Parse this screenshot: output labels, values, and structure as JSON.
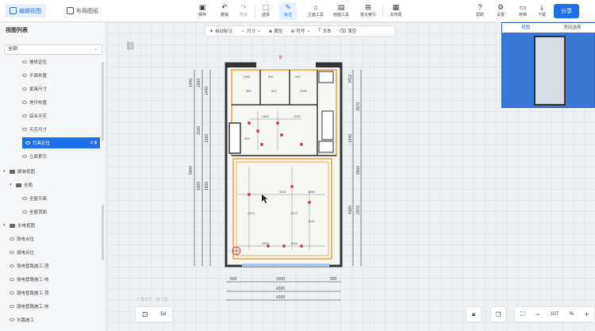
{
  "topbar": {
    "tabs": [
      {
        "label": "编辑视图",
        "active": true
      },
      {
        "label": "布局图纸",
        "active": false
      }
    ],
    "tools": [
      {
        "label": "保存",
        "icon": "save-icon",
        "glyph": "▣"
      },
      {
        "label": "撤销",
        "icon": "undo-icon",
        "glyph": "↶"
      },
      {
        "label": "重做",
        "icon": "redo-icon",
        "glyph": "↷",
        "disabled": true
      },
      {
        "label": "选择",
        "icon": "select-icon",
        "glyph": "⬚"
      },
      {
        "label": "标注",
        "icon": "annotate-icon",
        "glyph": "✎",
        "active": true
      },
      {
        "label": "立面工具",
        "icon": "elevation-icon",
        "glyph": "⌂"
      },
      {
        "label": "剖面工具",
        "icon": "section-icon",
        "glyph": "▤"
      },
      {
        "label": "放大索引",
        "icon": "zoom-index-icon",
        "glyph": "⊞"
      },
      {
        "label": "去布局",
        "icon": "layout-icon",
        "glyph": "▦"
      }
    ],
    "right_tools": [
      {
        "label": "帮助",
        "icon": "help-icon",
        "glyph": "?"
      },
      {
        "label": "设置",
        "icon": "settings-icon",
        "glyph": "⚙"
      },
      {
        "label": "存档",
        "icon": "archive-icon",
        "glyph": "▭"
      },
      {
        "label": "下载",
        "icon": "download-icon",
        "glyph": "⤓"
      }
    ],
    "share_label": "分享"
  },
  "sidebar": {
    "title": "视图列表",
    "select_value": "全部",
    "items": [
      {
        "label": "墙体定位",
        "level": 2
      },
      {
        "label": "平面布置",
        "level": 2
      },
      {
        "label": "家具尺寸",
        "level": 2
      },
      {
        "label": "地坪布置",
        "level": 2
      },
      {
        "label": "综合天花",
        "level": 2
      },
      {
        "label": "天花尺寸",
        "level": 2
      },
      {
        "label": "灯具定位",
        "level": 2,
        "selected": true
      },
      {
        "label": "立面索引",
        "level": 2
      },
      {
        "label": "硬装视图",
        "level": 0,
        "folder": true
      },
      {
        "label": "全局",
        "level": 1,
        "folder": true
      },
      {
        "label": "全屋平面",
        "level": 2
      },
      {
        "label": "全屋顶面",
        "level": 2
      },
      {
        "label": "水电视图",
        "level": 0,
        "folder": true
      },
      {
        "label": "强电点位",
        "level": 1
      },
      {
        "label": "弱电点位",
        "level": 1
      },
      {
        "label": "强电管路施工-顶",
        "level": 1
      },
      {
        "label": "强电管路施工-地",
        "level": 1
      },
      {
        "label": "弱电管路施工-顶",
        "level": 1
      },
      {
        "label": "弱电管路施工-地",
        "level": 1
      },
      {
        "label": "水路施工",
        "level": 1
      }
    ]
  },
  "canvas_toolbar": [
    {
      "label": "自动标注",
      "icon": "auto-annotate-icon",
      "glyph": "✦"
    },
    {
      "label": "尺寸",
      "icon": "dimension-icon",
      "glyph": "↔"
    },
    {
      "label": "属性",
      "icon": "property-icon",
      "glyph": "◈"
    },
    {
      "label": "符号",
      "icon": "symbol-icon",
      "glyph": "⊕"
    },
    {
      "label": "文本",
      "icon": "text-icon",
      "glyph": "T"
    },
    {
      "label": "清空",
      "icon": "clear-icon",
      "glyph": "⌫"
    }
  ],
  "minimap": {
    "tabs": [
      {
        "label": "视图",
        "active": true
      },
      {
        "label": "房间选择",
        "active": false
      }
    ]
  },
  "plan": {
    "top_label": "卧",
    "left_dims": [
      "1440",
      "1960",
      "8900",
      "2020",
      "1440",
      "4300",
      "1800",
      "1360"
    ],
    "right_dims": [
      "3412",
      "2970",
      "1440",
      "4160",
      "8900",
      "2970"
    ],
    "bottom_dims": [
      "500",
      "3300",
      "500",
      "4300",
      "4300"
    ],
    "inner_labels": [
      "1950",
      "550",
      "950",
      "550",
      "800",
      "2000",
      "1480",
      "1020",
      "500",
      "3300",
      "1000",
      "2670",
      "2670",
      "1140",
      "1600",
      "1600"
    ],
    "watermark": "© 酷家乐 · 施工图"
  },
  "bottom": {
    "left_label": "5d",
    "zoom_value": "107",
    "zoom_unit": "%"
  },
  "colors": {
    "accent": "#1d6fe8",
    "wall": "#333333",
    "lighting": "#e8a23a",
    "light_point": "#c0504d"
  }
}
